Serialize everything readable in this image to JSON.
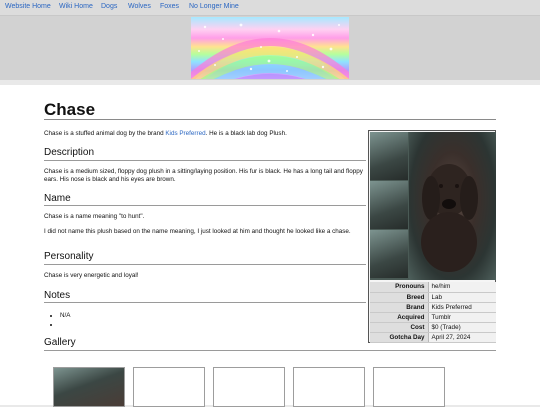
{
  "nav": {
    "links": [
      "Website Home",
      "Wiki Home",
      "Dogs",
      "Wolves",
      "Foxes",
      "No Longer Mine"
    ]
  },
  "page": {
    "title": "Chase",
    "intro_before": "Chase is a stuffed animal dog by the brand ",
    "intro_link": "Kids Preferred",
    "intro_after": ". He is a black lab dog Plush.",
    "sections": {
      "description": {
        "heading": "Description",
        "text": "Chase is a medium sized, floppy dog plush in a sitting/laying position. His fur is black. He has a long tail and floppy ears. His nose is black and his eyes are brown."
      },
      "name": {
        "heading": "Name",
        "text1": "Chase is a name meaning \"to hunt\".",
        "text2": "I did not name this plush based on the name meaning, I just looked at him and thought he looked like a chase."
      },
      "personality": {
        "heading": "Personality",
        "text": "Chase is very energetic and loyal!"
      },
      "notes": {
        "heading": "Notes",
        "items": [
          "N/A",
          ""
        ]
      },
      "gallery": {
        "heading": "Gallery"
      }
    }
  },
  "infobox": {
    "rows": [
      {
        "key": "Pronouns",
        "value": "he/him"
      },
      {
        "key": "Breed",
        "value": "Lab"
      },
      {
        "key": "Brand",
        "value": "Kids Preferred"
      },
      {
        "key": "Acquired",
        "value": "Tumblr"
      },
      {
        "key": "Cost",
        "value": "$0 (Trade)"
      },
      {
        "key": "Gotcha Day",
        "value": "April 27, 2024"
      }
    ]
  },
  "colors": {
    "link": "#2a66c2",
    "nav_bg": "#dcdcdc",
    "banner_band": "#d2d2d2"
  }
}
